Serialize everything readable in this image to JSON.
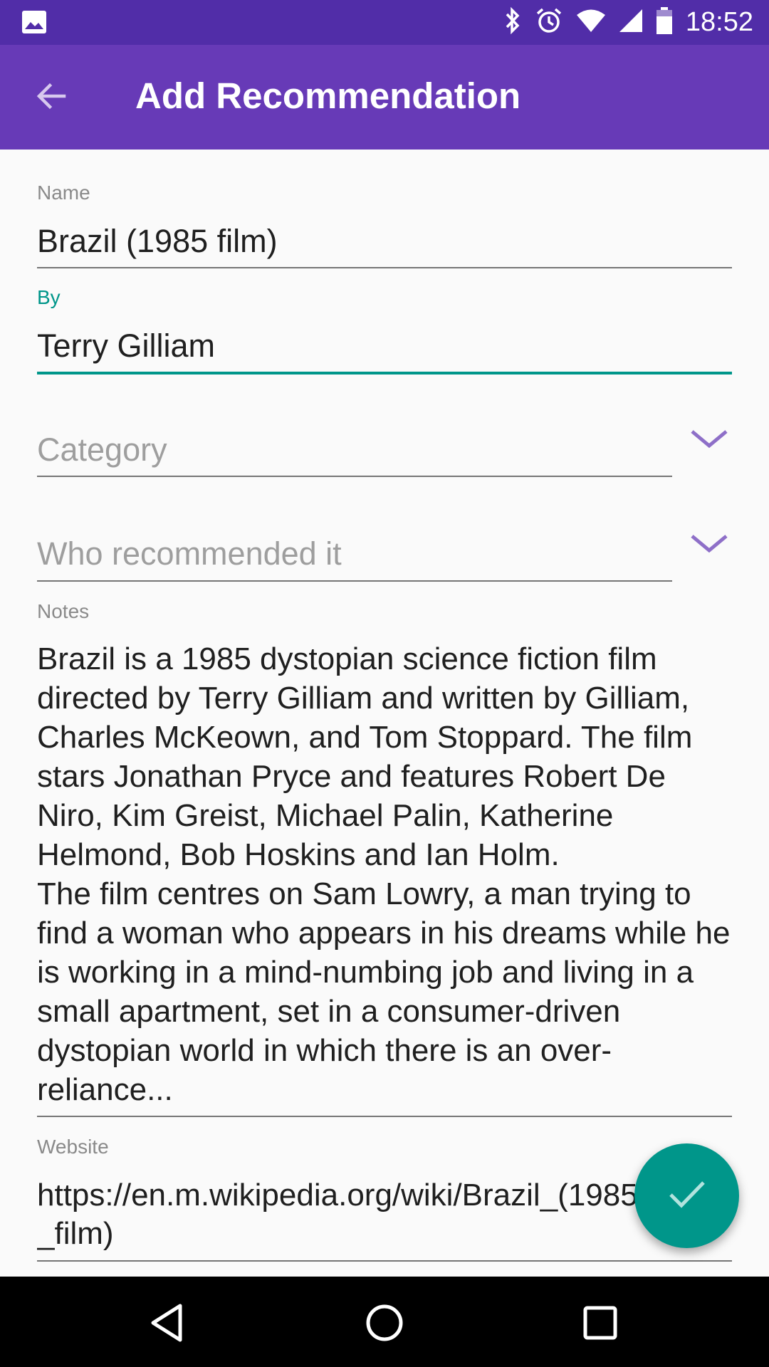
{
  "status_bar": {
    "time": "18:52",
    "icons": [
      "image-icon",
      "bluetooth-icon",
      "alarm-icon",
      "wifi-icon",
      "signal-icon",
      "battery-icon"
    ]
  },
  "app_bar": {
    "title": "Add Recommendation",
    "back_icon": "arrow-back-icon",
    "color": "#673ab7",
    "status_color": "#512da8"
  },
  "form": {
    "name": {
      "label": "Name",
      "value": "Brazil (1985 film)"
    },
    "by": {
      "label": "By",
      "value": "Terry Gilliam"
    },
    "category": {
      "placeholder": "Category"
    },
    "recommender": {
      "placeholder": "Who recommended it"
    },
    "notes": {
      "label": "Notes",
      "paragraph1": "Brazil is a 1985 dystopian science fiction film directed by Terry Gilliam and written by Gilliam, Charles McKeown, and Tom Stoppard. The film stars Jonathan Pryce and features Robert De Niro, Kim Greist, Michael Palin, Katherine Helmond, Bob Hoskins and Ian Holm.",
      "paragraph2": "The film centres on Sam Lowry, a man trying to find a woman who appears in his dreams while he is working in a mind-numbing job and living in a small apartment, set in a consumer-driven dystopian world in which there is an over-reliance..."
    },
    "website": {
      "label": "Website",
      "line1": "https://en.m.wikipedia.org/wiki/Brazil_(1985",
      "line2": "_film)"
    },
    "accent_color": "#00968a"
  },
  "fab": {
    "icon": "check-icon"
  },
  "nav_bar": {
    "back_icon": "nav-back-icon",
    "home_icon": "nav-home-icon",
    "recents_icon": "nav-recents-icon"
  }
}
